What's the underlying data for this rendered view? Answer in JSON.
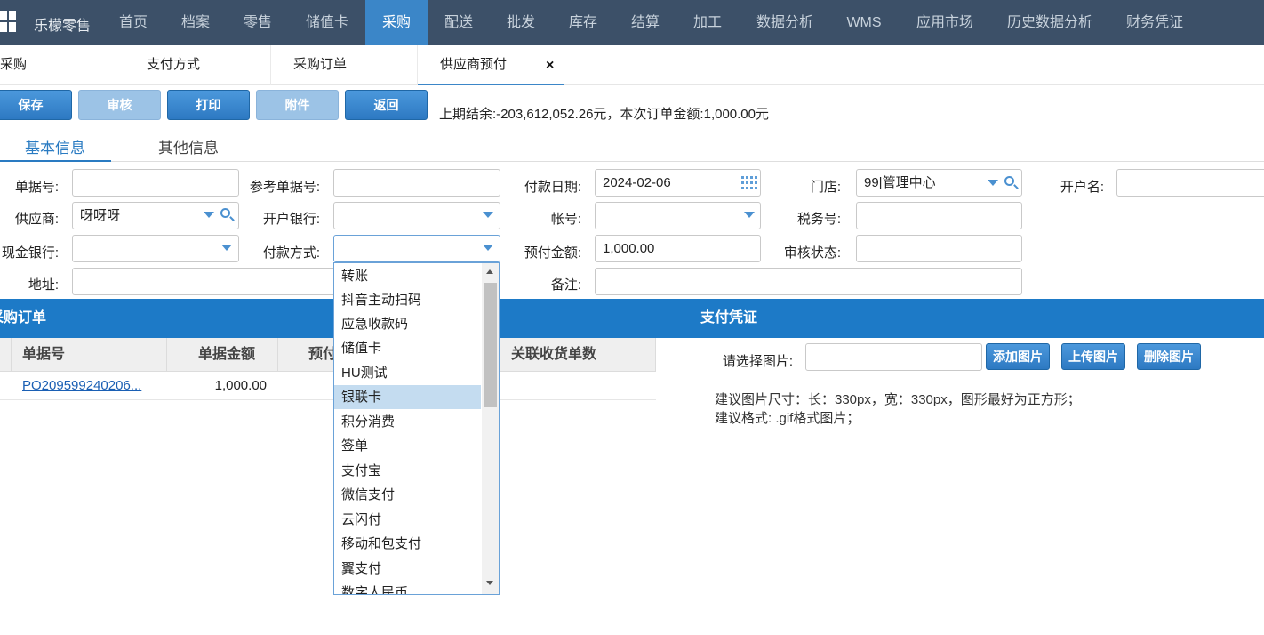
{
  "nav": {
    "brand": "乐檬零售",
    "items": [
      "首页",
      "档案",
      "零售",
      "储值卡",
      "采购",
      "配送",
      "批发",
      "库存",
      "结算",
      "加工",
      "数据分析",
      "WMS",
      "应用市场",
      "历史数据分析",
      "财务凭证"
    ],
    "active_index": 4
  },
  "tabs": [
    "采购",
    "支付方式",
    "采购订单",
    "供应商预付"
  ],
  "tab_close": "×",
  "toolbar": {
    "save": "保存",
    "audit": "审核",
    "print": "打印",
    "attach": "附件",
    "back": "返回",
    "balance_text": "上期结余:-203,612,052.26元，本次订单金额:1,000.00元"
  },
  "info_tabs": {
    "basic": "基本信息",
    "other": "其他信息"
  },
  "form": {
    "doc_no": {
      "label": "单据号:",
      "value": ""
    },
    "ref_no": {
      "label": "参考单据号:",
      "value": ""
    },
    "pay_date": {
      "label": "付款日期:",
      "value": "2024-02-06"
    },
    "store": {
      "label": "门店:",
      "value": "99|管理中心"
    },
    "account_name": {
      "label": "开户名:",
      "value": ""
    },
    "supplier": {
      "label": "供应商:",
      "value": "呀呀呀"
    },
    "bank": {
      "label": "开户银行:",
      "value": ""
    },
    "account_no": {
      "label": "帐号:",
      "value": ""
    },
    "tax_no": {
      "label": "税务号:",
      "value": ""
    },
    "cash_bank": {
      "label": "现金银行:",
      "value": ""
    },
    "pay_method": {
      "label": "付款方式:",
      "value": ""
    },
    "prepay_amount": {
      "label": "预付金额:",
      "value": "1,000.00"
    },
    "audit_status": {
      "label": "审核状态:",
      "value": ""
    },
    "address": {
      "label": "地址:",
      "value": ""
    },
    "remark": {
      "label": "备注:",
      "value": ""
    }
  },
  "orders_section": {
    "title": "采购订单",
    "columns": [
      "单据号",
      "单据金额",
      "预付",
      "关联收货单数"
    ],
    "rows": [
      {
        "doc_no": "PO209599240206...",
        "amount": "1,000.00"
      }
    ]
  },
  "voucher_section": {
    "title": "支付凭证",
    "select_label": "请选择图片:",
    "file_value": "",
    "add": "添加图片",
    "upload": "上传图片",
    "delete": "删除图片",
    "hint1": "建议图片尺寸：长：330px，宽：330px，图形最好为正方形；",
    "hint2": "建议格式: .gif格式图片；"
  },
  "dropdown": {
    "options": [
      "转账",
      "抖音主动扫码",
      "应急收款码",
      "储值卡",
      "HU测试",
      "银联卡",
      "积分消费",
      "签单",
      "支付宝",
      "微信支付",
      "云闪付",
      "移动和包支付",
      "翼支付",
      "数字人民币"
    ],
    "highlighted_index": 5
  },
  "colors": {
    "nav_bg": "#3c5068",
    "accent": "#1d7ac7",
    "link": "#1a5fb4"
  }
}
